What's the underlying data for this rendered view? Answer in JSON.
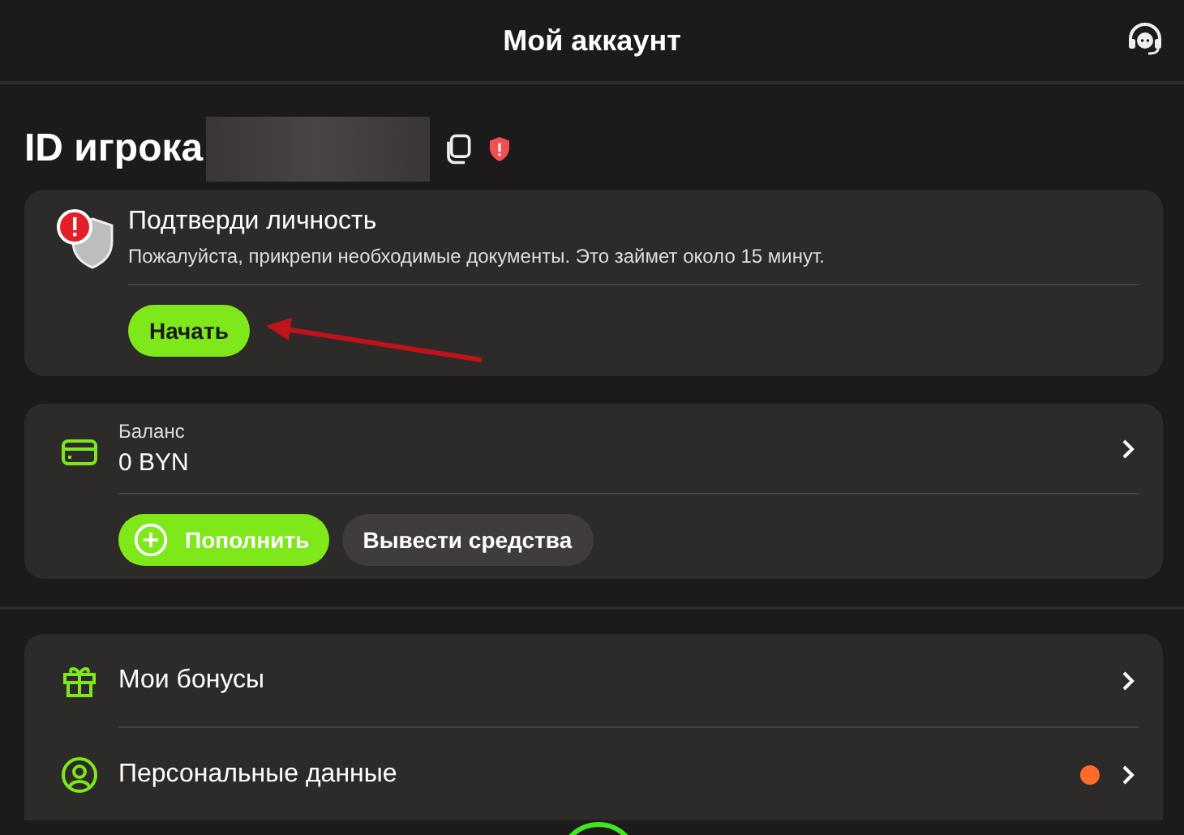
{
  "header": {
    "title": "Мой аккаунт"
  },
  "player": {
    "label": "ID игрока",
    "verified": false
  },
  "verification": {
    "title": "Подтверди личность",
    "text": "Пожалуйста, прикрепи необходимые документы. Это займет около 15 минут.",
    "button": "Начать"
  },
  "balance": {
    "label": "Баланс",
    "amount": "0 BYN",
    "deposit": "Пополнить",
    "withdraw": "Вывести средства"
  },
  "menu": [
    {
      "kind": "gift",
      "label": "Мои бонусы",
      "notification": false
    },
    {
      "kind": "user",
      "label": "Персональные данные",
      "notification": true
    }
  ]
}
